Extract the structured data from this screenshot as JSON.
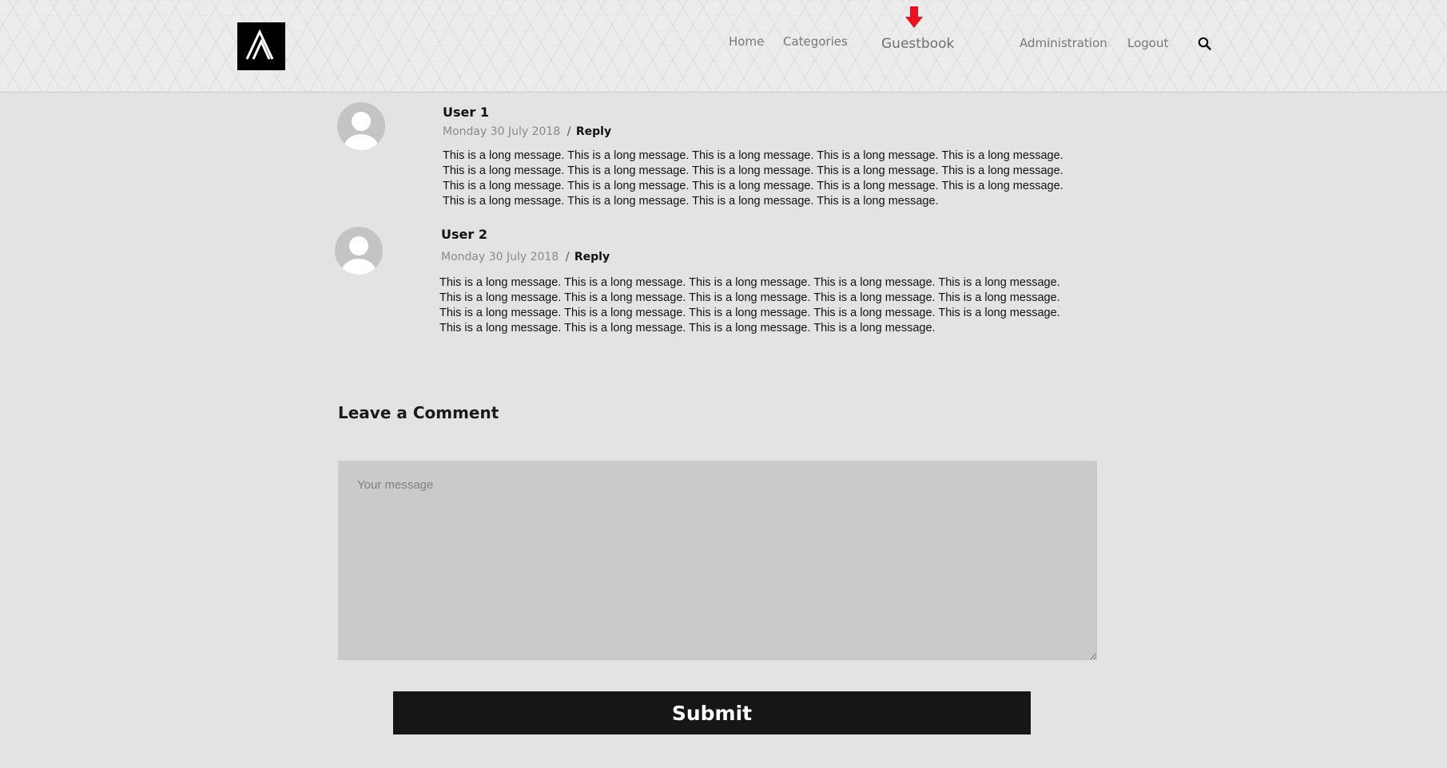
{
  "nav": {
    "home": "Home",
    "categories": "Categories",
    "guestbook": "Guestbook",
    "administration": "Administration",
    "logout": "Logout"
  },
  "icons": {
    "logo": "logo-icon",
    "arrow": "arrow-down-icon",
    "search": "search-icon",
    "avatar": "user-avatar-icon"
  },
  "colors": {
    "arrow": "#e8121f",
    "submit_bg": "#161616",
    "background": "#e3e3e3"
  },
  "comments": [
    {
      "user": "User 1",
      "date": "Monday 30 July 2018",
      "separator": "/",
      "reply": "Reply",
      "lines": [
        "This is a long message. This is a long message. This is a long message. This is a long message. This is a long message.",
        "This is a long message. This is a long message. This is a long message. This is a long message. This is a long message.",
        "This is a long message. This is a long message. This is a long message. This is a long message. This is a long message.",
        "This is a long message. This is a long message. This is a long message. This is a long message."
      ]
    },
    {
      "user": "User 2",
      "date": "Monday 30 July 2018",
      "separator": "/",
      "reply": "Reply",
      "lines": [
        "This is a long message. This is a long message. This is a long message. This is a long message. This is a long message.",
        "This is a long message. This is a long message. This is a long message. This is a long message. This is a long message.",
        "This is a long message. This is a long message. This is a long message. This is a long message. This is a long message.",
        "This is a long message. This is a long message. This is a long message. This is a long message."
      ]
    }
  ],
  "form": {
    "title": "Leave a Comment",
    "placeholder": "Your message",
    "value": "",
    "submit_label": "Submit"
  }
}
